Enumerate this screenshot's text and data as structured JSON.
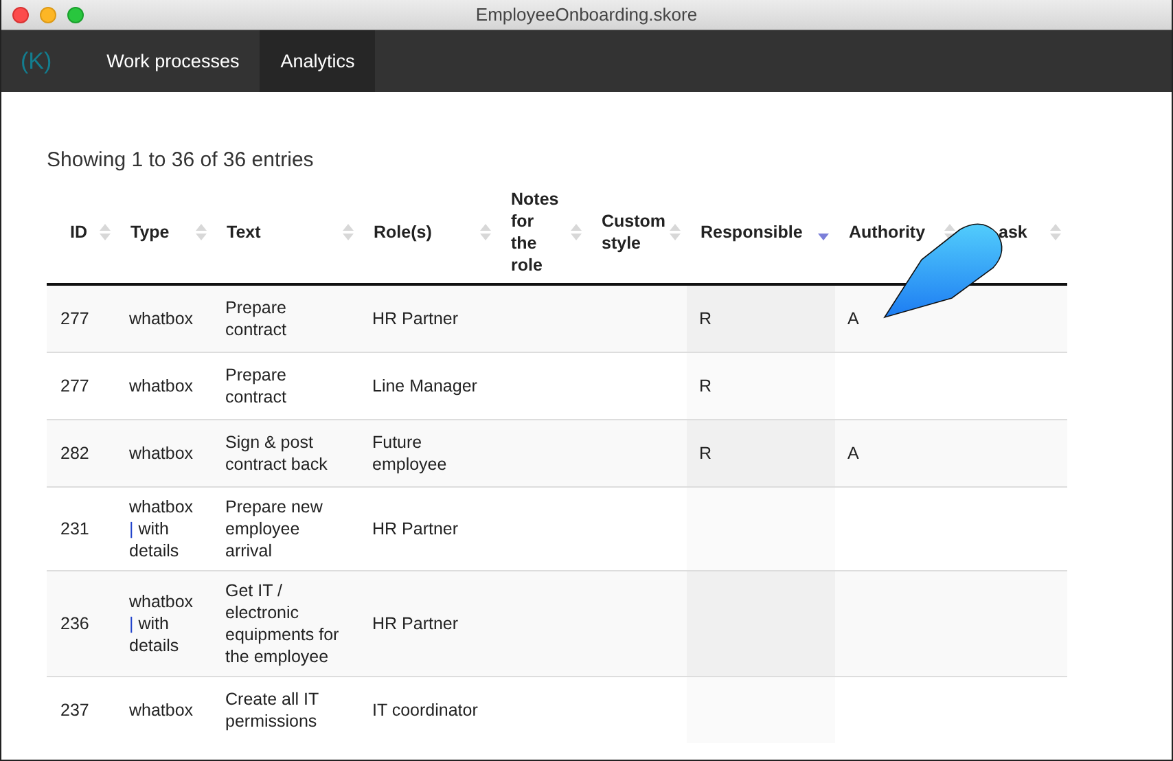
{
  "window": {
    "title": "EmployeeOnboarding.skore"
  },
  "nav": {
    "logo": "(K)",
    "tabs": [
      {
        "label": "Work processes",
        "selected": false
      },
      {
        "label": "Analytics",
        "selected": true
      }
    ]
  },
  "summary": "Showing 1 to 36 of 36 entries",
  "table": {
    "columns": [
      {
        "label": "ID",
        "sorted": false
      },
      {
        "label": "Type",
        "sorted": false
      },
      {
        "label": "Text",
        "sorted": false
      },
      {
        "label": "Role(s)",
        "sorted": false
      },
      {
        "label": "Notes for the role",
        "sorted": false
      },
      {
        "label": "Custom style",
        "sorted": false
      },
      {
        "label": "Responsible",
        "sorted": true
      },
      {
        "label": "Authority",
        "sorted": false
      },
      {
        "label": "ask",
        "sorted": false
      }
    ],
    "rows": [
      {
        "id": "277",
        "type": "whatbox",
        "text": "Prepare contract",
        "roles": "HR Partner",
        "responsible": "R",
        "authority": "A"
      },
      {
        "id": "277",
        "type": "whatbox",
        "text": "Prepare contract",
        "roles": "Line Manager",
        "responsible": "R"
      },
      {
        "id": "282",
        "type": "whatbox",
        "text": "Sign & post contract back",
        "roles": "Future employee",
        "responsible": "R",
        "authority": "A"
      },
      {
        "id": "231",
        "type": "whatbox",
        "separator": "|",
        "detail": "with details",
        "text": "Prepare new employee arrival",
        "roles": "HR Partner"
      },
      {
        "id": "236",
        "type": "whatbox",
        "separator": "|",
        "detail": "with details",
        "text": "Get IT / electronic equipments for the employee",
        "roles": "HR Partner"
      },
      {
        "id": "237",
        "type": "whatbox",
        "text": "Create all IT permissions",
        "roles": "IT coordinator"
      }
    ]
  },
  "callout": {
    "kind": "pointer"
  }
}
